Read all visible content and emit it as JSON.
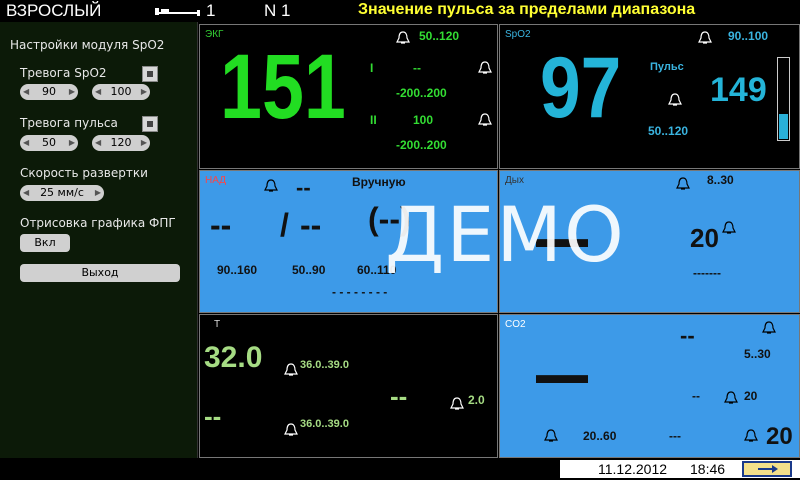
{
  "header": {
    "mode": "ВЗРОСЛЫЙ",
    "bed_number": "1",
    "patient_number": "N 1",
    "alarm_message": "Значение пульса за пределами диапазона"
  },
  "left_panel": {
    "title": "Настройки модуля SpO2",
    "spo2_alarm_label": "Тревога SpO2",
    "spo2_alarm_low": "90",
    "spo2_alarm_high": "100",
    "pulse_alarm_label": "Тревога пульса",
    "pulse_alarm_low": "50",
    "pulse_alarm_high": "120",
    "sweep_speed_label": "Скорость развертки",
    "sweep_speed_value": "25 мм/с",
    "ppg_draw_label": "Отрисовка графика ФПГ",
    "ppg_draw_value": "Вкл",
    "exit_label": "Выход"
  },
  "ecg": {
    "title": "ЭКГ",
    "hr": "151",
    "hr_range": "50..120",
    "lead1_label": "I",
    "lead1_value": "--",
    "lead1_range": "-200..200",
    "lead2_label": "II",
    "lead2_value": "100",
    "lead2_range": "-200..200"
  },
  "spo2": {
    "title": "SpO2",
    "value": "97",
    "range": "90..100",
    "pulse_label": "Пульс",
    "pulse_value": "149",
    "pulse_range": "50..120",
    "signal_level": 0.3
  },
  "nibp": {
    "title": "НАД",
    "top_value": "--",
    "mode": "Вручную",
    "sys": "--",
    "slash": "/",
    "dia": "--",
    "mean": "(--)",
    "sys_range": "90..160",
    "dia_range": "50..90",
    "mean_range": "60..110",
    "dashes": "- - - - - - - -"
  },
  "resp": {
    "title": "Дых",
    "range": "8..30",
    "value_blocks": "▬▬",
    "rate": "20",
    "dashes": "-------"
  },
  "temp": {
    "title": "T",
    "t1": "32.0",
    "t1_range": "36.0..39.0",
    "t2": "--",
    "t2_range": "36.0..39.0",
    "delta": "--",
    "delta_value": "2.0"
  },
  "co2": {
    "title": "CO2",
    "top_dash": "--",
    "range1": "5..30",
    "blocks": "▬▬",
    "mid_dash": "--",
    "mid_value": "20",
    "range2": "20..60",
    "bottom_dash": "---",
    "bottom_value": "20"
  },
  "overlay": {
    "watermark": "ДЕМО"
  },
  "status": {
    "date": "11.12.2012",
    "time": "18:46"
  }
}
